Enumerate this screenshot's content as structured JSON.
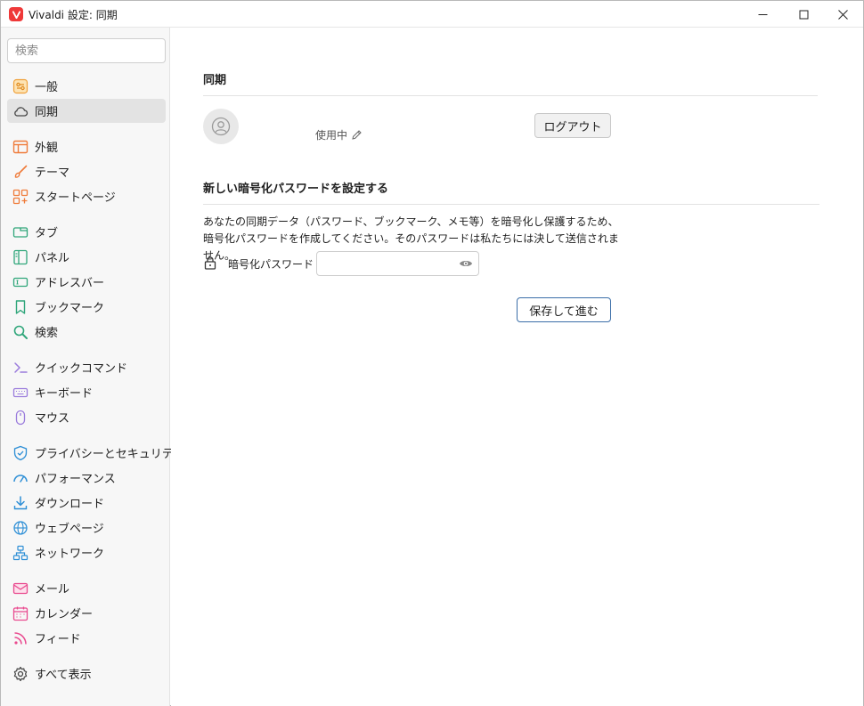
{
  "window": {
    "title": "Vivaldi 設定: 同期"
  },
  "sidebar": {
    "search_placeholder": "検索",
    "items": [
      {
        "label": "一般",
        "icon": "general-icon"
      },
      {
        "label": "同期",
        "icon": "cloud-icon",
        "active": true
      },
      {
        "label": "外観",
        "icon": "appearance-icon"
      },
      {
        "label": "テーマ",
        "icon": "brush-icon"
      },
      {
        "label": "スタートページ",
        "icon": "start-page-icon"
      },
      {
        "label": "タブ",
        "icon": "tab-icon"
      },
      {
        "label": "パネル",
        "icon": "panel-icon"
      },
      {
        "label": "アドレスバー",
        "icon": "address-bar-icon"
      },
      {
        "label": "ブックマーク",
        "icon": "bookmark-icon"
      },
      {
        "label": "検索",
        "icon": "search-icon"
      },
      {
        "label": "クイックコマンド",
        "icon": "quick-command-icon"
      },
      {
        "label": "キーボード",
        "icon": "keyboard-icon"
      },
      {
        "label": "マウス",
        "icon": "mouse-icon"
      },
      {
        "label": "プライバシーとセキュリティ",
        "icon": "shield-icon"
      },
      {
        "label": "パフォーマンス",
        "icon": "gauge-icon"
      },
      {
        "label": "ダウンロード",
        "icon": "download-icon"
      },
      {
        "label": "ウェブページ",
        "icon": "globe-icon"
      },
      {
        "label": "ネットワーク",
        "icon": "network-icon"
      },
      {
        "label": "メール",
        "icon": "mail-icon"
      },
      {
        "label": "カレンダー",
        "icon": "calendar-icon"
      },
      {
        "label": "フィード",
        "icon": "feed-icon"
      },
      {
        "label": "すべて表示",
        "icon": "gear-icon"
      }
    ]
  },
  "main": {
    "sync_title": "同期",
    "status_text": "使用中",
    "logout_label": "ログアウト",
    "encryption_title": "新しい暗号化パスワードを設定する",
    "description": "あなたの同期データ（パスワード、ブックマーク、メモ等）を暗号化し保護するため、暗号化パスワードを作成してください。そのパスワードは私たちには決して送信されません。",
    "password_label": "暗号化パスワード",
    "password_value": "",
    "save_label": "保存して進む"
  },
  "colors": {
    "accent": "#3b6ea8",
    "vivaldi_red": "#ef3939",
    "sidebar_bg": "#f7f7f7",
    "active_item_bg": "#e3e3e3"
  }
}
